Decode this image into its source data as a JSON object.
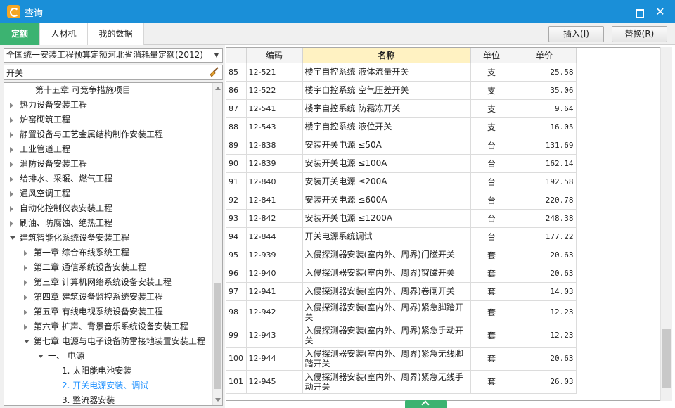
{
  "window": {
    "title": "查询"
  },
  "tabs": {
    "quota": "定额",
    "labor": "人材机",
    "mydata": "我的数据"
  },
  "actions": {
    "insert": "插入(I)",
    "replace": "替换(R)"
  },
  "left": {
    "combo_value": "全国统一安装工程预算定额河北省消耗量定额(2012)",
    "search_value": "开关",
    "tree": [
      {
        "label": "第十五章  可竞争措施项目",
        "level": 1,
        "arrow": "none"
      },
      {
        "label": "热力设备安装工程",
        "level": 0,
        "arrow": "right"
      },
      {
        "label": "炉窑砌筑工程",
        "level": 0,
        "arrow": "right"
      },
      {
        "label": "静置设备与工艺金属结构制作安装工程",
        "level": 0,
        "arrow": "right"
      },
      {
        "label": "工业管道工程",
        "level": 0,
        "arrow": "right"
      },
      {
        "label": "消防设备安装工程",
        "level": 0,
        "arrow": "right"
      },
      {
        "label": "给排水、采暖、燃气工程",
        "level": 0,
        "arrow": "right"
      },
      {
        "label": "通风空调工程",
        "level": 0,
        "arrow": "right"
      },
      {
        "label": "自动化控制仪表安装工程",
        "level": 0,
        "arrow": "right"
      },
      {
        "label": "刷油、防腐蚀、绝热工程",
        "level": 0,
        "arrow": "right"
      },
      {
        "label": "建筑智能化系统设备安装工程",
        "level": 0,
        "arrow": "down"
      },
      {
        "label": "第一章  综合布线系统工程",
        "level": 1,
        "arrow": "right"
      },
      {
        "label": "第二章  通信系统设备安装工程",
        "level": 1,
        "arrow": "right"
      },
      {
        "label": "第三章  计算机网络系统设备安装工程",
        "level": 1,
        "arrow": "right"
      },
      {
        "label": "第四章  建筑设备监控系统安装工程",
        "level": 1,
        "arrow": "right"
      },
      {
        "label": "第五章  有线电视系统设备安装工程",
        "level": 1,
        "arrow": "right"
      },
      {
        "label": "第六章  扩声、背景音乐系统设备安装工程",
        "level": 1,
        "arrow": "right"
      },
      {
        "label": "第七章  电源与电子设备防雷接地装置安装工程",
        "level": 1,
        "arrow": "down"
      },
      {
        "label": "一、  电源",
        "level": 2,
        "arrow": "down"
      },
      {
        "label": "1.  太阳能电池安装",
        "level": 3,
        "arrow": "none"
      },
      {
        "label": "2.  开关电源安装、调试",
        "level": 3,
        "arrow": "none",
        "active": true
      },
      {
        "label": "3.  整流器安装",
        "level": 3,
        "arrow": "none"
      }
    ]
  },
  "table": {
    "headers": {
      "code": "编码",
      "name": "名称",
      "unit": "单位",
      "price": "单价"
    },
    "rows": [
      {
        "no": "85",
        "code": "12-521",
        "name": "楼宇自控系统 液体流量开关",
        "unit": "支",
        "price": "25.58"
      },
      {
        "no": "86",
        "code": "12-522",
        "name": "楼宇自控系统 空气压差开关",
        "unit": "支",
        "price": "35.06"
      },
      {
        "no": "87",
        "code": "12-541",
        "name": "楼宇自控系统 防霜冻开关",
        "unit": "支",
        "price": "9.64"
      },
      {
        "no": "88",
        "code": "12-543",
        "name": "楼宇自控系统 液位开关",
        "unit": "支",
        "price": "16.05"
      },
      {
        "no": "89",
        "code": "12-838",
        "name": "安装开关电源 ≤50A",
        "unit": "台",
        "price": "131.69"
      },
      {
        "no": "90",
        "code": "12-839",
        "name": "安装开关电源 ≤100A",
        "unit": "台",
        "price": "162.14"
      },
      {
        "no": "91",
        "code": "12-840",
        "name": "安装开关电源 ≤200A",
        "unit": "台",
        "price": "192.58"
      },
      {
        "no": "92",
        "code": "12-841",
        "name": "安装开关电源 ≤600A",
        "unit": "台",
        "price": "220.78"
      },
      {
        "no": "93",
        "code": "12-842",
        "name": "安装开关电源 ≤1200A",
        "unit": "台",
        "price": "248.38"
      },
      {
        "no": "94",
        "code": "12-844",
        "name": "开关电源系统调试",
        "unit": "台",
        "price": "177.22"
      },
      {
        "no": "95",
        "code": "12-939",
        "name": "入侵探测器安装(室内外、周界)门磁开关",
        "unit": "套",
        "price": "20.63"
      },
      {
        "no": "96",
        "code": "12-940",
        "name": "入侵探测器安装(室内外、周界)窗磁开关",
        "unit": "套",
        "price": "20.63"
      },
      {
        "no": "97",
        "code": "12-941",
        "name": "入侵探测器安装(室内外、周界)卷闸开关",
        "unit": "套",
        "price": "14.03"
      },
      {
        "no": "98",
        "code": "12-942",
        "name": "入侵探测器安装(室内外、周界)紧急脚踏开关",
        "unit": "套",
        "price": "12.23"
      },
      {
        "no": "99",
        "code": "12-943",
        "name": "入侵探测器安装(室内外、周界)紧急手动开关",
        "unit": "套",
        "price": "12.23"
      },
      {
        "no": "100",
        "code": "12-944",
        "name": "入侵探测器安装(室内外、周界)紧急无线脚踏开关",
        "unit": "套",
        "price": "20.63"
      },
      {
        "no": "101",
        "code": "12-945",
        "name": "入侵探测器安装(室内外、周界)紧急无线手动开关",
        "unit": "套",
        "price": "26.03"
      }
    ]
  }
}
